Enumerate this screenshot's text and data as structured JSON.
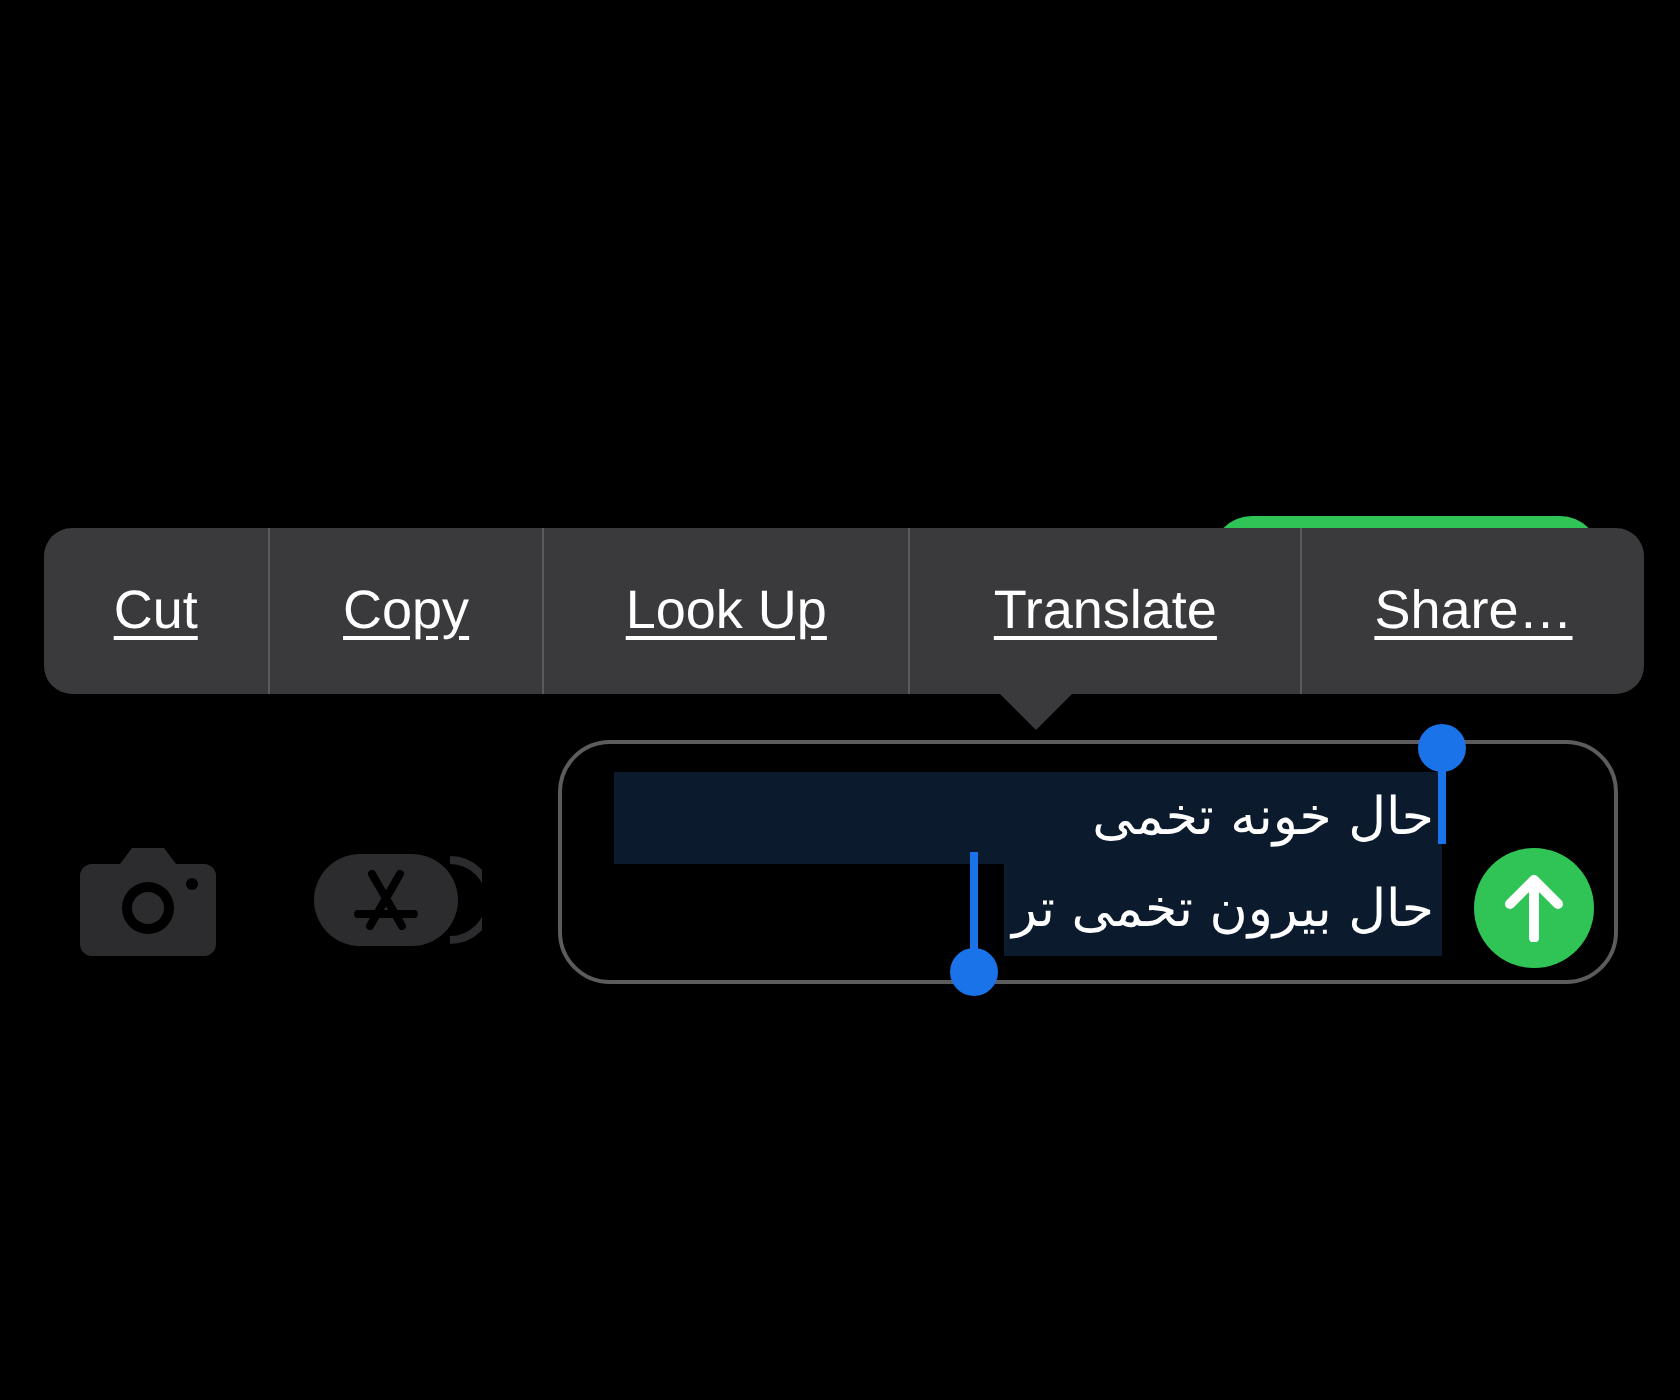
{
  "edit_menu": {
    "items": [
      {
        "label": "Cut"
      },
      {
        "label": "Copy"
      },
      {
        "label": "Look Up"
      },
      {
        "label": "Translate"
      },
      {
        "label": "Share…"
      }
    ]
  },
  "composer": {
    "lines": [
      {
        "text": "حال خونه تخمی",
        "selected": true
      },
      {
        "text": "حال بیرون تخمی تر",
        "selected": true
      }
    ]
  }
}
